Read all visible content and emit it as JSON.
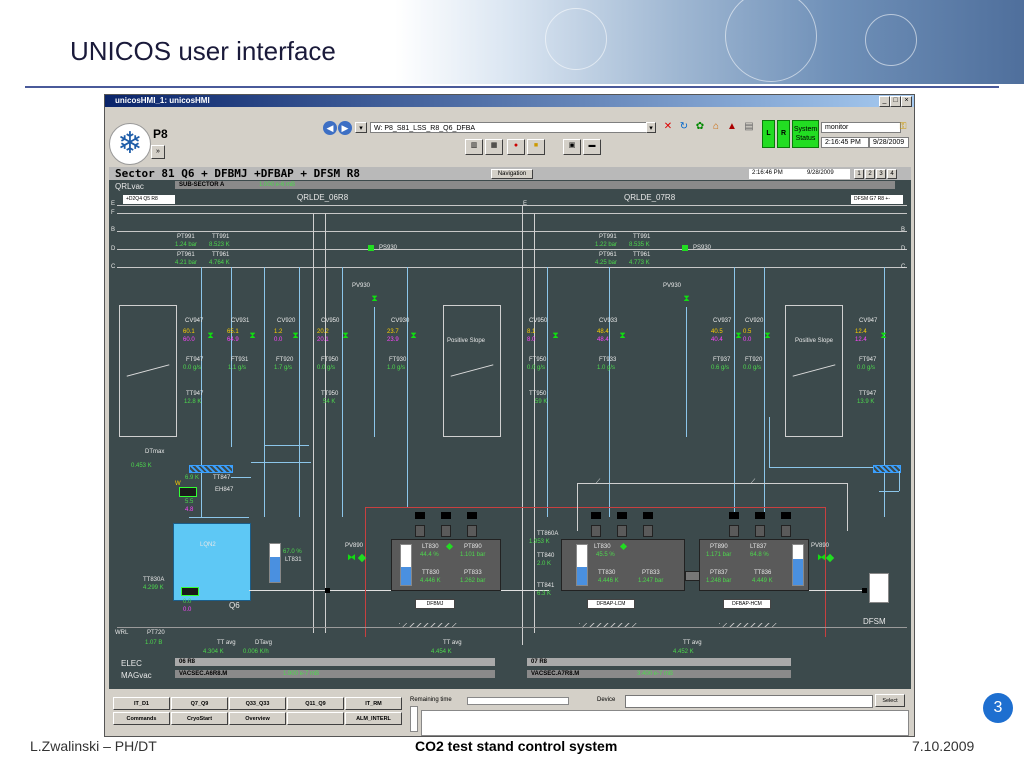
{
  "slide": {
    "title": "UNICOS user interface",
    "footer_left": "L.Zwalinski – PH/DT",
    "footer_center": "CO2 test stand control system",
    "footer_right": "7.10.2009",
    "page_number": "3"
  },
  "window": {
    "title": "unicosHMI_1: unicosHMI",
    "app_label": "P8",
    "expand_label": "»",
    "url": "W: P8_S81_LSS_R8_Q6_DFBA",
    "system_status": {
      "l": "L",
      "r": "R",
      "label": "System Status"
    },
    "user": "monitor",
    "clock": "2:16:45 PM",
    "date": "9/28/2009"
  },
  "hmi": {
    "sector_title": "Sector 81 Q6 + DFBMJ +DFBAP + DFSM R8",
    "navigation": "Navigation",
    "time": "2:16:46 PM",
    "date": "9/28/2009",
    "pages": [
      "1",
      "2",
      "3",
      "4"
    ],
    "qrlvac": "QRLvac",
    "subsector": "SUB-SECTOR A",
    "subsector_value": "1.000 e-6 mB",
    "nav_left": "+D2Q4 Q5 R8",
    "nav_right": "DFSM G7 R8 +-",
    "left_title": "QRLDE_06R8",
    "right_title": "QRLDE_07R8",
    "lines": {
      "e": "E",
      "f": "F",
      "b": "B",
      "d": "D",
      "c": "C"
    },
    "left": {
      "pt991": "PT991",
      "tt991": "TT991",
      "pt991_v": "1.24 bar",
      "tt991_v": "8.523 K",
      "pt961": "PT961",
      "tt961": "TT961",
      "pt961_v": "4.21 bar",
      "tt961_v": "4.764 K",
      "ps930": "PS930",
      "pv930": "PV930",
      "cv947": "CV947",
      "cv947_a": "60.1",
      "cv947_b": "60.0",
      "cv931": "CV931",
      "cv931_a": "65.1",
      "cv931_b": "64.9",
      "cv920": "CV920",
      "cv920_a": "1.2",
      "cv920_b": "0.0",
      "cv950": "CV950",
      "cv950_a": "20.2",
      "cv950_b": "20.1",
      "cv930": "CV930",
      "cv930_a": "23.7",
      "cv930_b": "23.9",
      "ft947": "FT947",
      "ft947_v": "0.0 g/s",
      "ft931": "FT931",
      "ft931_v": "1.1 g/s",
      "ft920": "FT920",
      "ft920_v": "1.7 g/s",
      "ft950": "FT950",
      "ft950_v": "0.0 g/s",
      "ft930": "FT930",
      "ft930_v": "1.0 g/s",
      "tt947": "TT947",
      "tt947_v": "12.8 K",
      "tt950": "TT950",
      "tt950_v": "54 K",
      "positive_slope": "Positive Slope",
      "dtmax": "DTmax",
      "dtmax_v": "0.453 K",
      "tt847_v": "6.9 K",
      "tt847": "TT847",
      "eh847": "EH847",
      "eh847_a": "5.5",
      "eh847_b": "4.8",
      "lqn2": "LQN2",
      "lt831_pct": "67.0 %",
      "lt831": "LT831",
      "tt830a": "TT830A",
      "tt830a_v": "4.299 K",
      "q6": "Q6",
      "q6_a": "0.0",
      "q6_b": "0.0",
      "pv890": "PV890"
    },
    "dfbmj": {
      "lt830": "LT830",
      "lt830_v": "44.4 %",
      "pt890": "PT890",
      "pt890_v": "1.101 bar",
      "tt830": "TT830",
      "tt830_v": "4.446 K",
      "pt833": "PT833",
      "pt833_v": "1.262 bar",
      "tag": "DFBMJ"
    },
    "right": {
      "pt991": "PT991",
      "tt991": "TT991",
      "pt991_v": "1.22 bar",
      "tt991_v": "8.535 K",
      "pt961": "PT961",
      "tt961": "TT961",
      "pt961_v": "4.25 bar",
      "tt961_v": "4.773 K",
      "ps930": "PS930",
      "pv930": "PV930",
      "cv950": "CV950",
      "cv950_a": "8.1",
      "cv950_b": "8.0",
      "cv933": "CV933",
      "cv933_a": "48.4",
      "cv933_b": "48.4",
      "cv937": "CV937",
      "cv937_a": "40.5",
      "cv937_b": "40.4",
      "cv920": "CV920",
      "cv920_a": "0.5",
      "cv920_b": "0.0",
      "cv947": "CV947",
      "cv947_a": "12.4",
      "cv947_b": "12.4",
      "ft950": "FT950",
      "ft950_v": "0.0 g/s",
      "ft933": "FT933",
      "ft933_v": "1.0 g/s",
      "ft937": "FT937",
      "ft937_v": "0.6 g/s",
      "ft920": "FT920",
      "ft920_v": "0.0 g/s",
      "ft947": "FT947",
      "ft947_v": "0.0 g/s",
      "tt950": "TT950",
      "tt950_v": "59 K",
      "tt947": "TT947",
      "tt947_v": "13.9 K",
      "positive_slope": "Positive Slope",
      "tt860a": "TT860A",
      "tt860a_v": "1.953 K",
      "tt840": "TT840",
      "tt840_v": "2.0 K",
      "tt841": "TT841",
      "tt841_v": "6.3 K",
      "pv890": "PV890"
    },
    "dfbap_lcm": {
      "lt830": "LT830",
      "lt830_v": "45.5 %",
      "tt830": "TT830",
      "tt830_v": "4.446 K",
      "pt833": "PT833",
      "pt833_v": "1.247 bar",
      "tag": "DFBAP-LCM"
    },
    "dfbap_hcm": {
      "pt890": "PT890",
      "pt890_v": "1.171 bar",
      "lt837": "LT837",
      "lt837_v": "64.8 %",
      "pt837": "PT837",
      "pt837_v": "1.248 bar",
      "tt836": "TT836",
      "tt836_v": "4.449 K",
      "tag": "DFBAP-HCM"
    },
    "dfsm": "DFSM",
    "wrl": "WRL",
    "pt720": "PT720",
    "pt720_v": "1.07 B",
    "ttavg_l": "TT avg",
    "ttavg_l_v": "4.304 K",
    "dtavg": "DTavg",
    "dtavg_v": "0.006 K/h",
    "ttavg_m": "TT avg",
    "ttavg_m_v": "4.454 K",
    "ttavg_r": "TT avg",
    "ttavg_r_v": "4.452 K",
    "elec": "ELEC",
    "elec_l": "06 R8",
    "elec_r": "07 R8",
    "magvac": "MAGvac",
    "magvac_l": "VACSEC.A6R8.M",
    "magvac_l_v": "1.900 e-7 mB",
    "magvac_r": "VACSEC.A7R8.M",
    "magvac_r_v": "3.400 e-7 mB"
  },
  "bottom": {
    "row1": [
      "IT_D1",
      "Q7_Q9",
      "Q33_Q33",
      "Q11_Q9",
      "IT_RM"
    ],
    "row2": [
      "Commands",
      "CryoStart",
      "Overview",
      "",
      "ALM_INTERL"
    ],
    "remaining": "Remaining time",
    "device": "Device",
    "select": "Select"
  },
  "colors": {
    "accent": "#22dd22",
    "hmi_bg": "#3c4a4c",
    "value_green": "#4dd84d",
    "value_magenta": "#ff44ff"
  }
}
